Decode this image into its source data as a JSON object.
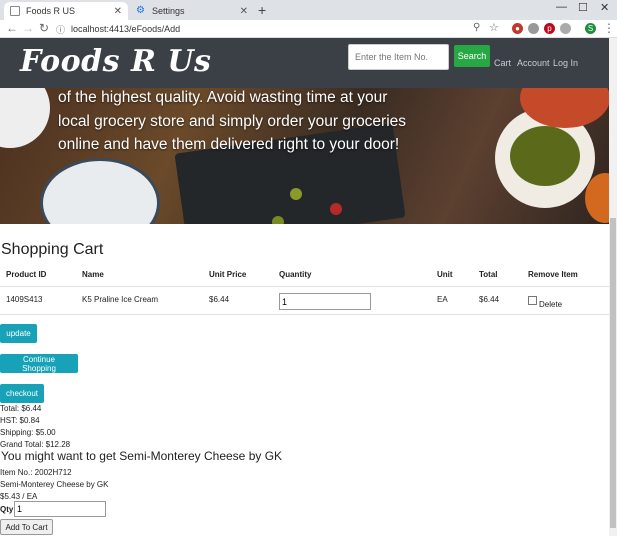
{
  "browser": {
    "tabs": [
      {
        "title": "Foods R US"
      },
      {
        "title": "Settings"
      }
    ],
    "url": "localhost:4413/eFoods/Add"
  },
  "site": {
    "brand": "Foods R Us",
    "search_placeholder": "Enter the Item No.",
    "search_button": "Search",
    "nav": {
      "cart": "Cart",
      "account": "Account",
      "login": "Log In"
    },
    "hero_lines": [
      "of the highest quality. Avoid wasting time at your",
      "local grocery store and simply order your groceries",
      "online and have them delivered right to your door!"
    ]
  },
  "cart": {
    "title": "Shopping Cart",
    "columns": [
      "Product ID",
      "Name",
      "Unit Price",
      "Quantity",
      "Unit",
      "Total",
      "Remove Item"
    ],
    "rows": [
      {
        "product_id": "1409S413",
        "name": "K5 Praline Ice Cream",
        "unit_price": "$6.44",
        "quantity": "1",
        "unit": "EA",
        "total": "$6.44",
        "remove_label": "Delete"
      }
    ],
    "buttons": {
      "update": "update",
      "continue": "Continue Shopping",
      "checkout": "checkout"
    },
    "summary": {
      "total": "Total: $6.44",
      "hst": "HST: $0.84",
      "shipping": "Shipping: $5.00",
      "grand_total": "Grand Total: $12.28"
    }
  },
  "recommendation": {
    "title": "You might want to get Semi-Monterey Cheese by GK",
    "item_no": "Item No.: 2002H712",
    "name": "Semi-Monterey Cheese by GK",
    "price": "$5.43 / EA",
    "qty_label": "Qty:",
    "qty_value": "1",
    "add_button": "Add To Cart"
  },
  "colors": {
    "header_bg": "#3b4047",
    "search_btn": "#28a745",
    "info_btn": "#17a2b8"
  }
}
